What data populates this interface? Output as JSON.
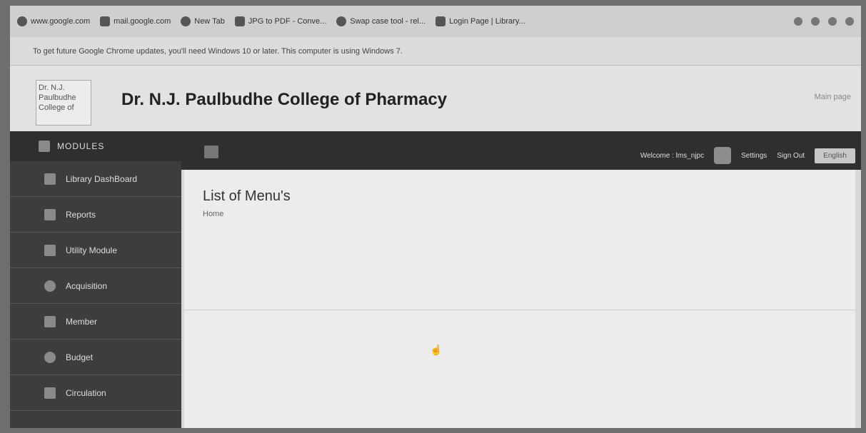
{
  "bookmarks": [
    {
      "label": "www.google.com",
      "icon": "google-icon"
    },
    {
      "label": "mail.google.com",
      "icon": "gmail-icon"
    },
    {
      "label": "New Tab",
      "icon": "chrome-icon"
    },
    {
      "label": "JPG to PDF - Conve...",
      "icon": "converter-icon"
    },
    {
      "label": "Swap case tool - rel...",
      "icon": "tool-icon"
    },
    {
      "label": "Login Page | Library...",
      "icon": "library-icon"
    }
  ],
  "banner": {
    "text": "To get future Google Chrome updates, you'll need Windows 10 or later. This computer is using Windows 7."
  },
  "header": {
    "logo_alt": "Dr. N.J. Paulbudhe College of",
    "title": "Dr. N.J. Paulbudhe College of Pharmacy",
    "link": "Main page"
  },
  "sidebar": {
    "heading": "MODULES",
    "items": [
      {
        "label": "Library DashBoard",
        "icon": "dashboard-icon"
      },
      {
        "label": "Reports",
        "icon": "reports-icon"
      },
      {
        "label": "Utility Module",
        "icon": "utility-icon"
      },
      {
        "label": "Acquisition",
        "icon": "acquisition-icon"
      },
      {
        "label": "Member",
        "icon": "member-icon"
      },
      {
        "label": "Budget",
        "icon": "budget-icon"
      },
      {
        "label": "Circulation",
        "icon": "circulation-icon"
      }
    ]
  },
  "topbar": {
    "welcome": "Welcome : lms_njpc",
    "settings": "Settings",
    "sign_out": "Sign Out",
    "language": "English"
  },
  "main": {
    "title": "List of Menu's",
    "breadcrumb": "Home"
  }
}
